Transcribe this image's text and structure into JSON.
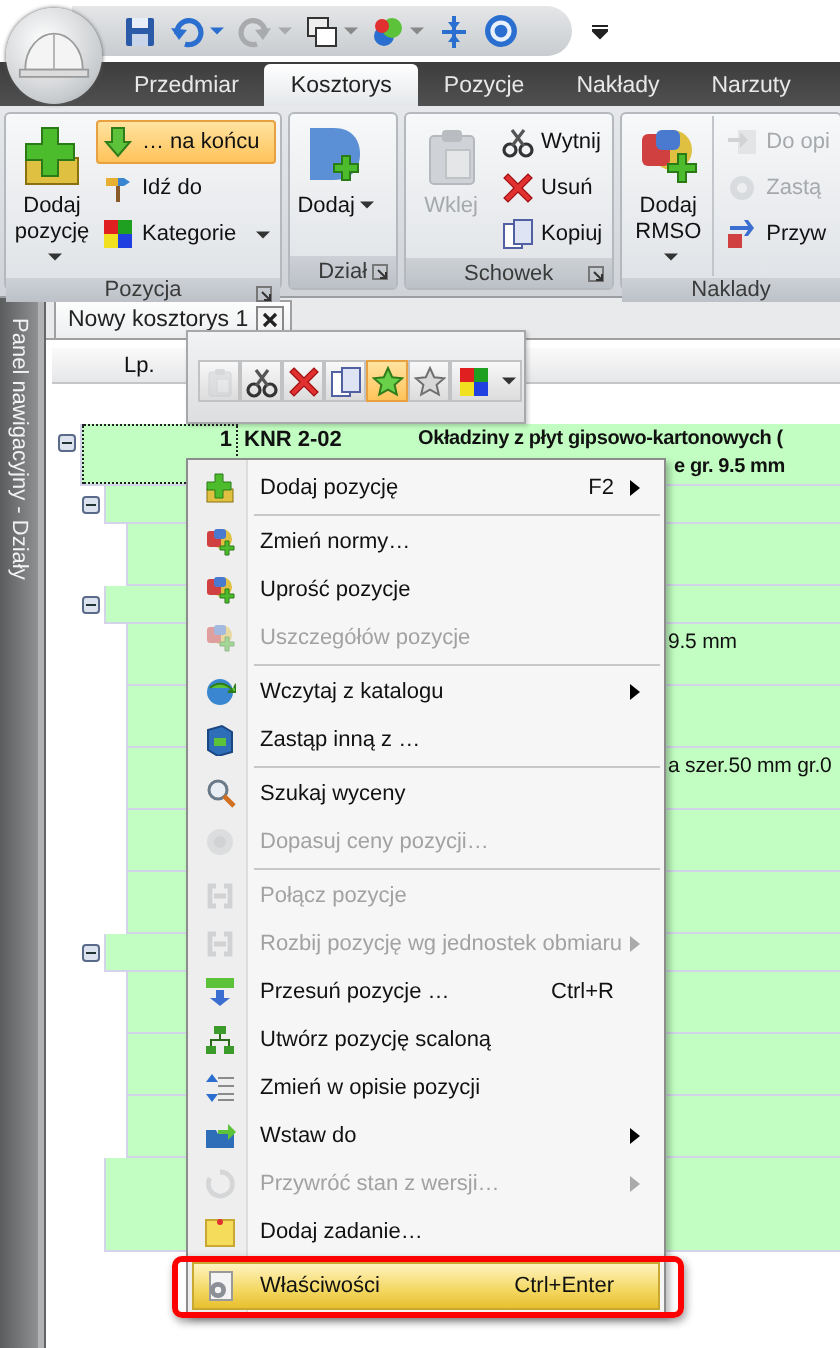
{
  "tabs": [
    {
      "label": "Przedmiar",
      "selected": false
    },
    {
      "label": "Kosztorys",
      "selected": true
    },
    {
      "label": "Pozycje",
      "selected": false
    },
    {
      "label": "Nakłady",
      "selected": false
    },
    {
      "label": "Narzuty",
      "selected": false
    }
  ],
  "ribbon": {
    "groups": [
      {
        "title": "Pozycja",
        "launcher": true,
        "large": [
          {
            "label": "Dodaj pozycję",
            "dropdown": true,
            "disabled": false
          }
        ],
        "small": [
          {
            "label": "… na końcu",
            "highlighted": true,
            "disabled": false,
            "dropdown": false
          },
          {
            "label": "Idź do",
            "highlighted": false,
            "disabled": false,
            "dropdown": false
          },
          {
            "label": "Kategorie",
            "highlighted": false,
            "disabled": false,
            "dropdown": true
          }
        ]
      },
      {
        "title": "Dział",
        "launcher": true,
        "large": [
          {
            "label": "Dodaj",
            "dropdown": true,
            "disabled": false
          }
        ]
      },
      {
        "title": "Schowek",
        "launcher": true,
        "large": [
          {
            "label": "Wklej",
            "dropdown": false,
            "disabled": true
          }
        ],
        "small": [
          {
            "label": "Wytnij",
            "highlighted": false,
            "disabled": false,
            "dropdown": false
          },
          {
            "label": "Usuń",
            "highlighted": false,
            "disabled": false,
            "dropdown": false
          },
          {
            "label": "Kopiuj",
            "highlighted": false,
            "disabled": false,
            "dropdown": false
          }
        ]
      },
      {
        "title": "Naklady",
        "launcher": false,
        "large": [
          {
            "label": "Dodaj RMSO",
            "dropdown": true,
            "disabled": false
          }
        ],
        "small": [
          {
            "label": "Do opi",
            "highlighted": false,
            "disabled": true,
            "dropdown": false
          },
          {
            "label": "Zastą",
            "highlighted": false,
            "disabled": true,
            "dropdown": false
          },
          {
            "label": "Przyw",
            "highlighted": false,
            "disabled": false,
            "dropdown": false
          }
        ]
      }
    ]
  },
  "side_panel": {
    "title": "Panel nawigacyjny - Działy"
  },
  "document_tab": {
    "title": "Nowy kosztorys 1"
  },
  "grid": {
    "columns": [
      {
        "label": "Lp."
      }
    ],
    "rows": [
      {
        "kind": "position",
        "lp": "1",
        "code": "KNR 2-02",
        "description": [
          "Okładziny z płyt gipsowo-kartonowych (",
          "e gr. 9.5 mm"
        ],
        "expanded": true,
        "children": [
          {
            "kind": "group",
            "expanded": true,
            "children": [
              {
                "kind": "item"
              }
            ]
          },
          {
            "kind": "group",
            "expanded": true,
            "children": [
              {
                "kind": "item",
                "description": "9.5 mm"
              },
              {
                "kind": "item"
              },
              {
                "kind": "item",
                "description": "a szer.50 mm gr.0"
              },
              {
                "kind": "item"
              },
              {
                "kind": "item"
              }
            ]
          },
          {
            "kind": "group",
            "expanded": true,
            "children": [
              {
                "kind": "item"
              },
              {
                "kind": "item"
              },
              {
                "kind": "item"
              }
            ]
          },
          {
            "kind": "item"
          }
        ]
      }
    ]
  },
  "mini_toolbar": {
    "buttons": [
      {
        "disabled": true,
        "highlighted": false
      },
      {
        "disabled": false,
        "highlighted": false
      },
      {
        "disabled": false,
        "highlighted": false
      },
      {
        "disabled": false,
        "highlighted": false
      },
      {
        "disabled": false,
        "highlighted": true
      },
      {
        "disabled": false,
        "highlighted": false
      },
      {
        "disabled": false,
        "highlighted": false
      }
    ]
  },
  "context_menu": {
    "highlight_frame": true,
    "items": [
      {
        "kind": "item",
        "label": "Dodaj pozycję",
        "shortcut": "F2",
        "submenu": true,
        "disabled": false,
        "selected": false
      },
      {
        "kind": "separator"
      },
      {
        "kind": "item",
        "label": "Zmień normy…",
        "submenu": false,
        "disabled": false,
        "selected": false
      },
      {
        "kind": "item",
        "label": "Uprość pozycje",
        "submenu": false,
        "disabled": false,
        "selected": false
      },
      {
        "kind": "item",
        "label": "Uszczegółów pozycje",
        "submenu": false,
        "disabled": true,
        "selected": false
      },
      {
        "kind": "separator"
      },
      {
        "kind": "item",
        "label": "Wczytaj z katalogu",
        "submenu": true,
        "disabled": false,
        "selected": false
      },
      {
        "kind": "item",
        "label": "Zastąp inną z …",
        "submenu": false,
        "disabled": false,
        "selected": false
      },
      {
        "kind": "separator"
      },
      {
        "kind": "item",
        "label": "Szukaj wyceny",
        "submenu": false,
        "disabled": false,
        "selected": false
      },
      {
        "kind": "item",
        "label": "Dopasuj ceny pozycji…",
        "submenu": false,
        "disabled": true,
        "selected": false
      },
      {
        "kind": "separator"
      },
      {
        "kind": "item",
        "label": "Połącz pozycje",
        "submenu": false,
        "disabled": true,
        "selected": false
      },
      {
        "kind": "item",
        "label": "Rozbij pozycję wg jednostek obmiaru",
        "submenu": true,
        "disabled": true,
        "selected": false
      },
      {
        "kind": "item",
        "label": "Przesuń pozycje …",
        "shortcut": "Ctrl+R",
        "submenu": false,
        "disabled": false,
        "selected": false
      },
      {
        "kind": "item",
        "label": "Utwórz pozycję scaloną",
        "submenu": false,
        "disabled": false,
        "selected": false
      },
      {
        "kind": "item",
        "label": "Zmień w opisie pozycji",
        "submenu": false,
        "disabled": false,
        "selected": false
      },
      {
        "kind": "item",
        "label": "Wstaw do",
        "submenu": true,
        "disabled": false,
        "selected": false
      },
      {
        "kind": "item",
        "label": "Przywróć stan z wersji…",
        "submenu": true,
        "disabled": true,
        "selected": false
      },
      {
        "kind": "item",
        "label": "Dodaj zadanie…",
        "submenu": false,
        "disabled": false,
        "selected": false
      },
      {
        "kind": "separator"
      },
      {
        "kind": "item",
        "label": "Właściwości",
        "shortcut": "Ctrl+Enter",
        "submenu": false,
        "disabled": false,
        "selected": true
      }
    ]
  }
}
